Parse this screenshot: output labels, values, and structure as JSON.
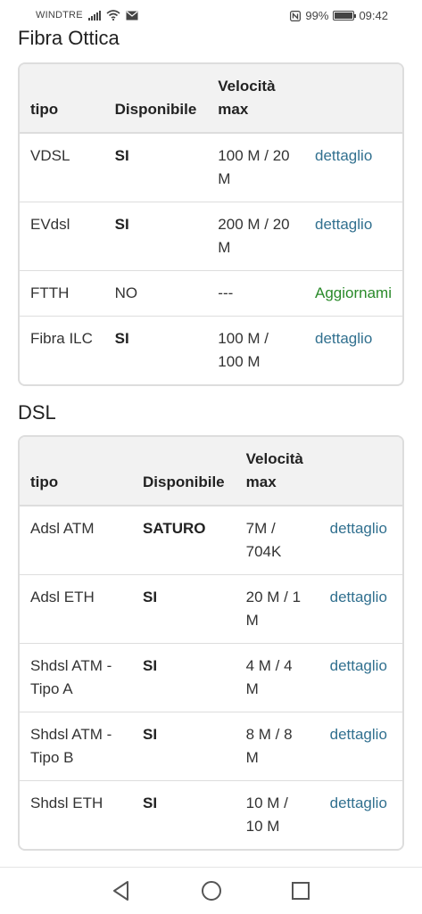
{
  "status_bar": {
    "carrier": "WINDTRE",
    "battery_percent": "99%",
    "time": "09:42",
    "battery_level": 0.99
  },
  "fibra": {
    "title": "Fibra Ottica",
    "headers": [
      "tipo",
      "Disponibile",
      "Velocità max",
      ""
    ],
    "rows": [
      {
        "tipo": "VDSL",
        "disponibile": "SI",
        "velocita": "100 M / 20 M",
        "link": "dettaglio"
      },
      {
        "tipo": "EVdsl",
        "disponibile": "SI",
        "velocita": "200 M / 20 M",
        "link": "dettaglio"
      },
      {
        "tipo": "FTTH",
        "disponibile": "NO",
        "velocita": "---",
        "link": "Aggiornami"
      },
      {
        "tipo": "Fibra ILC",
        "disponibile": "SI",
        "velocita": "100 M / 100 M",
        "link": "dettaglio"
      }
    ]
  },
  "dsl": {
    "title": "DSL",
    "headers": [
      "tipo",
      "Disponibile",
      "Velocità max",
      ""
    ],
    "rows": [
      {
        "tipo": "Adsl ATM",
        "disponibile": "SATURO",
        "velocita": "7M / 704K",
        "link": "dettaglio"
      },
      {
        "tipo": "Adsl ETH",
        "disponibile": "SI",
        "velocita": "20 M / 1 M",
        "link": "dettaglio"
      },
      {
        "tipo": "Shdsl ATM - Tipo A",
        "disponibile": "SI",
        "velocita": "4 M / 4 M",
        "link": "dettaglio"
      },
      {
        "tipo": "Shdsl ATM - Tipo B",
        "disponibile": "SI",
        "velocita": "8 M / 8 M",
        "link": "dettaglio"
      },
      {
        "tipo": "Shdsl ETH",
        "disponibile": "SI",
        "velocita": "10 M / 10 M",
        "link": "dettaglio"
      }
    ]
  },
  "colors": {
    "link": "#31708f",
    "upgrade_link": "#2a8a2a",
    "header_bg": "#f2f2f2",
    "border": "#dddddd"
  },
  "nav_bar": {
    "icons": [
      "back-triangle-icon",
      "home-circle-icon",
      "recents-square-icon"
    ]
  }
}
